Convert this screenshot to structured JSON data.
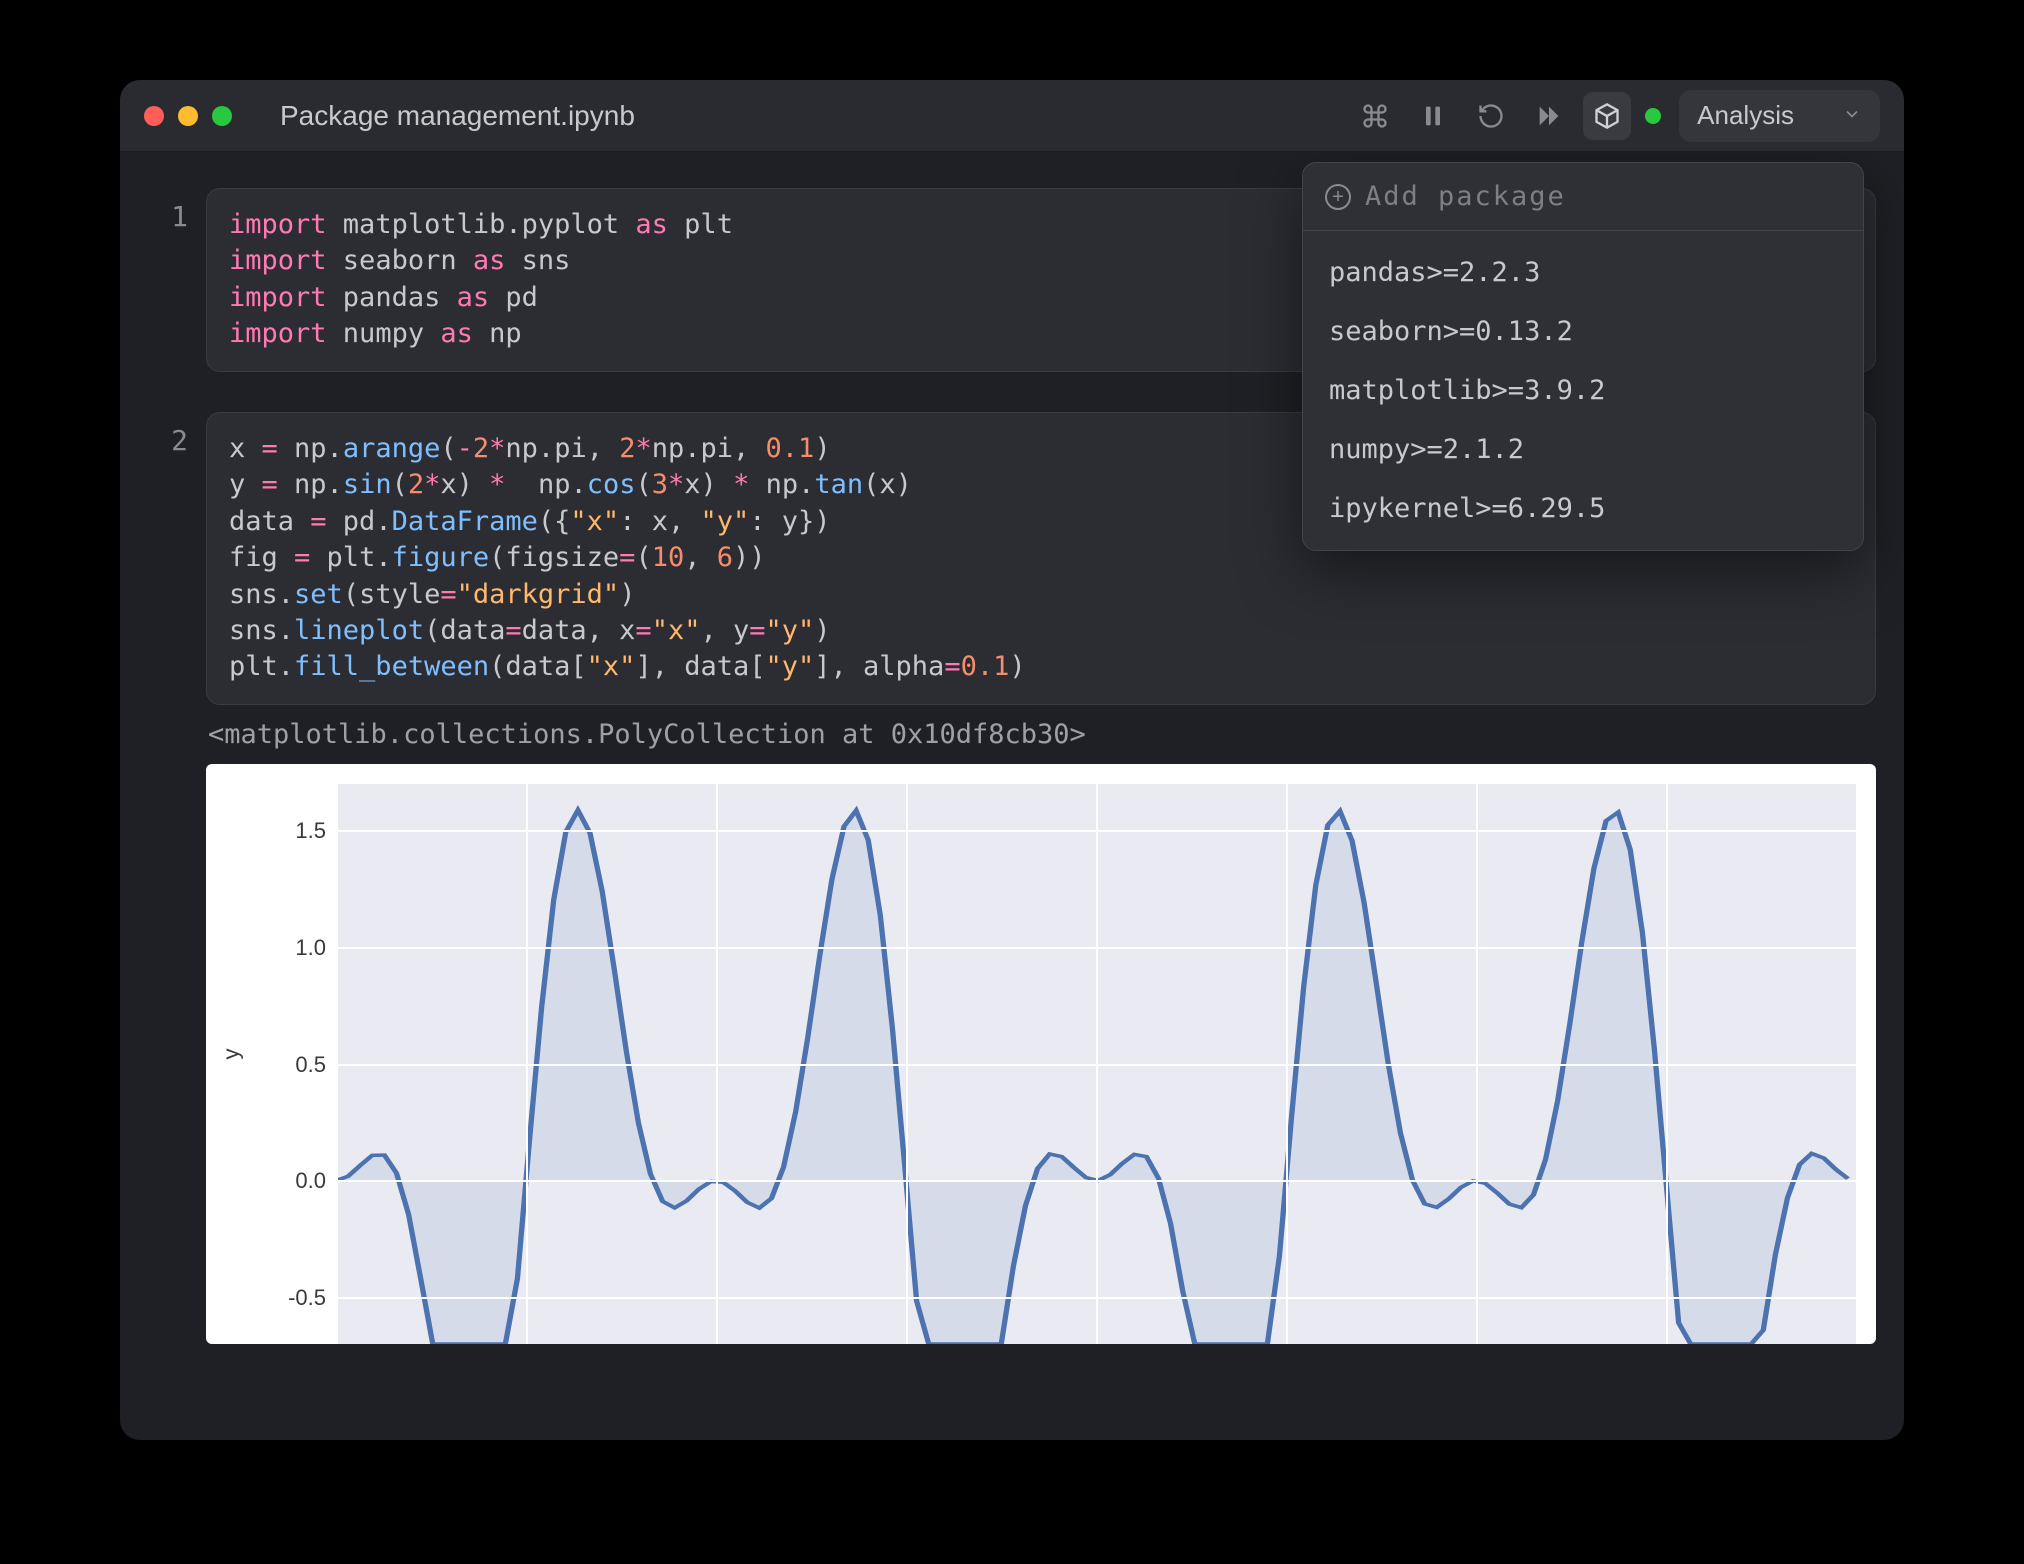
{
  "window": {
    "title": "Package management.ipynb"
  },
  "toolbar": {
    "kernel_name": "Analysis",
    "status_color": "#28c840",
    "icons": [
      "command-palette",
      "pause",
      "restart",
      "run-all",
      "package-manager"
    ]
  },
  "package_popover": {
    "placeholder": "Add package",
    "items": [
      "pandas>=2.2.3",
      "seaborn>=0.13.2",
      "matplotlib>=3.9.2",
      "numpy>=2.1.2",
      "ipykernel>=6.29.5"
    ]
  },
  "cells": [
    {
      "number": "1",
      "code_tokens": [
        [
          "k",
          "import"
        ],
        [
          "n",
          " matplotlib.pyplot "
        ],
        [
          "k",
          "as"
        ],
        [
          "n",
          " plt\n"
        ],
        [
          "k",
          "import"
        ],
        [
          "n",
          " seaborn "
        ],
        [
          "k",
          "as"
        ],
        [
          "n",
          " sns\n"
        ],
        [
          "k",
          "import"
        ],
        [
          "n",
          " pandas "
        ],
        [
          "k",
          "as"
        ],
        [
          "n",
          " pd\n"
        ],
        [
          "k",
          "import"
        ],
        [
          "n",
          " numpy "
        ],
        [
          "k",
          "as"
        ],
        [
          "n",
          " np"
        ]
      ]
    },
    {
      "number": "2",
      "code_tokens": [
        [
          "n",
          "x "
        ],
        [
          "op",
          "="
        ],
        [
          "n",
          " np."
        ],
        [
          "f",
          "arange"
        ],
        [
          "n",
          "("
        ],
        [
          "op",
          "-"
        ],
        [
          "num",
          "2"
        ],
        [
          "op",
          "*"
        ],
        [
          "n",
          "np.pi, "
        ],
        [
          "num",
          "2"
        ],
        [
          "op",
          "*"
        ],
        [
          "n",
          "np.pi, "
        ],
        [
          "num",
          "0.1"
        ],
        [
          "n",
          ")\n"
        ],
        [
          "n",
          "y "
        ],
        [
          "op",
          "="
        ],
        [
          "n",
          " np."
        ],
        [
          "f",
          "sin"
        ],
        [
          "n",
          "("
        ],
        [
          "num",
          "2"
        ],
        [
          "op",
          "*"
        ],
        [
          "n",
          "x) "
        ],
        [
          "op",
          "*"
        ],
        [
          "n",
          "  np."
        ],
        [
          "f",
          "cos"
        ],
        [
          "n",
          "("
        ],
        [
          "num",
          "3"
        ],
        [
          "op",
          "*"
        ],
        [
          "n",
          "x) "
        ],
        [
          "op",
          "*"
        ],
        [
          "n",
          " np."
        ],
        [
          "f",
          "tan"
        ],
        [
          "n",
          "(x)\n"
        ],
        [
          "n",
          "data "
        ],
        [
          "op",
          "="
        ],
        [
          "n",
          " pd."
        ],
        [
          "f",
          "DataFrame"
        ],
        [
          "n",
          "({"
        ],
        [
          "s",
          "\"x\""
        ],
        [
          "n",
          ": x, "
        ],
        [
          "s",
          "\"y\""
        ],
        [
          "n",
          ": y})\n"
        ],
        [
          "n",
          "fig "
        ],
        [
          "op",
          "="
        ],
        [
          "n",
          " plt."
        ],
        [
          "f",
          "figure"
        ],
        [
          "n",
          "(figsize"
        ],
        [
          "op",
          "="
        ],
        [
          "n",
          "("
        ],
        [
          "num",
          "10"
        ],
        [
          "n",
          ", "
        ],
        [
          "num",
          "6"
        ],
        [
          "n",
          "))\n"
        ],
        [
          "n",
          "sns."
        ],
        [
          "f",
          "set"
        ],
        [
          "n",
          "(style"
        ],
        [
          "op",
          "="
        ],
        [
          "s",
          "\"darkgrid\""
        ],
        [
          "n",
          ")\n"
        ],
        [
          "n",
          "sns."
        ],
        [
          "f",
          "lineplot"
        ],
        [
          "n",
          "(data"
        ],
        [
          "op",
          "="
        ],
        [
          "n",
          "data, x"
        ],
        [
          "op",
          "="
        ],
        [
          "s",
          "\"x\""
        ],
        [
          "n",
          ", y"
        ],
        [
          "op",
          "="
        ],
        [
          "s",
          "\"y\""
        ],
        [
          "n",
          ")\n"
        ],
        [
          "n",
          "plt."
        ],
        [
          "f",
          "fill_between"
        ],
        [
          "n",
          "(data["
        ],
        [
          "s",
          "\"x\""
        ],
        [
          "n",
          "], data["
        ],
        [
          "s",
          "\"y\""
        ],
        [
          "n",
          "], alpha"
        ],
        [
          "op",
          "="
        ],
        [
          "num",
          "0.1"
        ],
        [
          "n",
          ")"
        ]
      ],
      "output_text": "<matplotlib.collections.PolyCollection at 0x10df8cb30>"
    }
  ],
  "chart_data": {
    "type": "line",
    "title": "",
    "xlabel": "",
    "ylabel": "y",
    "ylim": [
      -0.7,
      1.7
    ],
    "yticks": [
      -0.5,
      0.0,
      0.5,
      1.0,
      1.5
    ],
    "x_range": [
      -6.2832,
      6.2832
    ],
    "x_step": 0.1,
    "series": [
      {
        "name": "y",
        "formula": "sin(2x)*cos(3x)*tan(x)",
        "color": "#4c72b0"
      }
    ],
    "fill_alpha": 0.1,
    "style": "seaborn-darkgrid",
    "grid": true
  }
}
